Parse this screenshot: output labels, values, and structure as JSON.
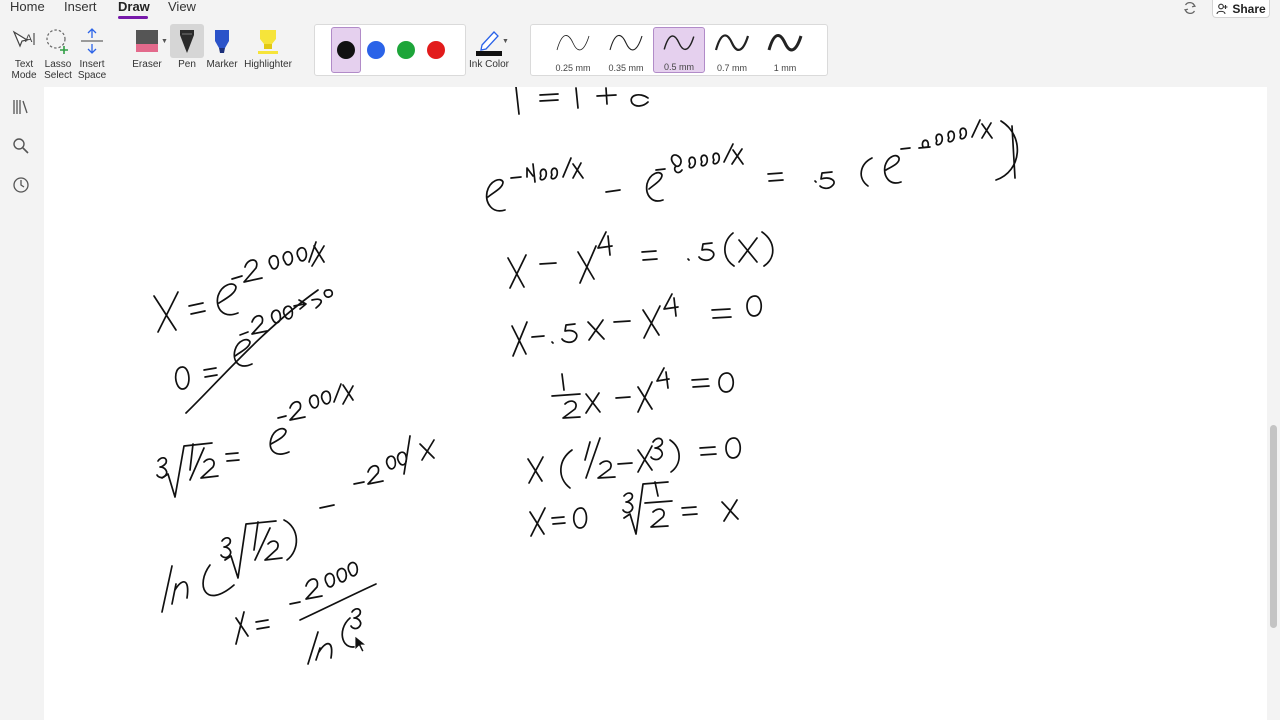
{
  "menu": {
    "tabs": [
      "Home",
      "Insert",
      "Draw",
      "View"
    ],
    "active_tab": "Draw",
    "share_label": "Share"
  },
  "ribbon": {
    "text_mode": "Text Mode",
    "lasso_select": "Lasso Select",
    "insert_space": "Insert Space",
    "eraser": "Eraser",
    "pen": "Pen",
    "marker": "Marker",
    "highlighter": "Highlighter",
    "ink_color": "Ink Color",
    "pen_colors": [
      "#111111",
      "#2b63e8",
      "#1ea53a",
      "#e21b1b"
    ],
    "selected_color_index": 0,
    "thickness": [
      "0.25 mm",
      "0.35 mm",
      "0.5 mm",
      "0.7 mm",
      "1 mm"
    ],
    "selected_thickness_index": 2
  },
  "colors": {
    "accent": "#7719aa",
    "selected_bg": "#e5d0ee",
    "ink": "#111111"
  },
  "icons": {
    "sync": "sync-icon",
    "share": "share-icon",
    "notebooks": "notebooks-icon",
    "search": "search-icon",
    "recent": "recent-icon"
  },
  "ink_notes": {
    "top_partial": "| = 1 + e",
    "line_1": "e^(-400/λ) − e^(-8000/λ) = .5(e^(-2000/λ))",
    "line_2": "X − X⁴ = .5(X)",
    "line_3": "X − .5X − X⁴ = 0",
    "line_4": "½X − X⁴ = 0",
    "line_5": "X(½ − X³) = 0",
    "line_6": "X = 0    ∛½ = X",
    "left_1": "X = e^(-2000/λ)",
    "left_2": "0 = e^(-200) → 0",
    "left_3": "∛½ = e^(-200/λ)",
    "left_4": "ln(∛½) = -2000/λ",
    "left_5": "λ = -2000 / ln(∛"
  }
}
